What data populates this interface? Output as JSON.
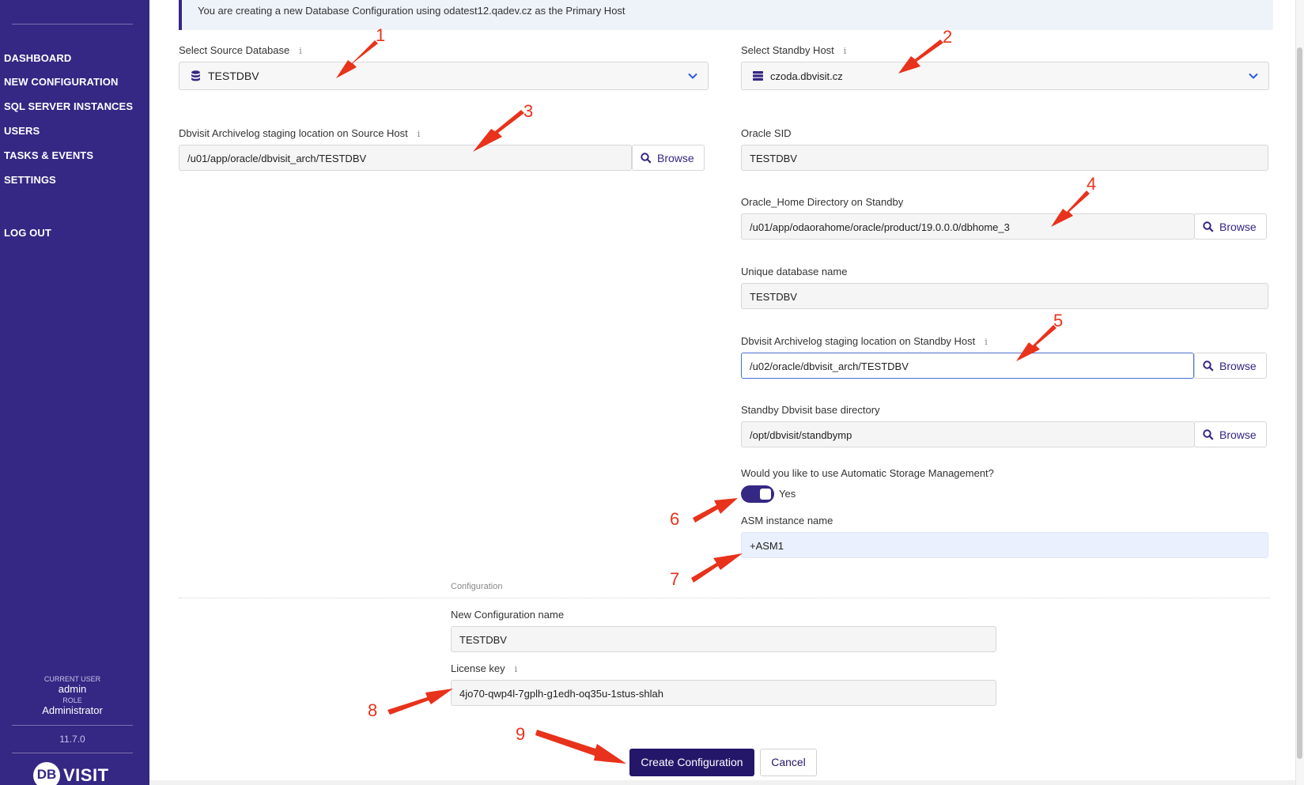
{
  "sidebar": {
    "nav": [
      "DASHBOARD",
      "NEW CONFIGURATION",
      "SQL SERVER INSTANCES",
      "USERS",
      "TASKS & EVENTS",
      "SETTINGS"
    ],
    "logout": "LOG OUT",
    "current_user_label": "CURRENT USER",
    "current_user": "admin",
    "role_label": "ROLE",
    "role": "Administrator",
    "version": "11.7.0",
    "logo": {
      "db": "DB",
      "visit": "VISIT"
    }
  },
  "banner": "You are creating a new Database Configuration using odatest12.qadev.cz as the Primary Host",
  "form": {
    "source_db": {
      "label": "Select Source Database",
      "value": "TESTDBV",
      "icon": "database-icon"
    },
    "standby_host": {
      "label": "Select Standby Host",
      "value": "czoda.dbvisit.cz",
      "icon": "server-icon"
    },
    "source_staging": {
      "label": "Dbvisit Archivelog staging location on Source Host",
      "value": "/u01/app/oracle/dbvisit_arch/TESTDBV"
    },
    "oracle_sid": {
      "label": "Oracle SID",
      "value": "TESTDBV"
    },
    "oracle_home": {
      "label": "Oracle_Home Directory on Standby",
      "value": "/u01/app/odaorahome/oracle/product/19.0.0.0/dbhome_3"
    },
    "unique_db_name": {
      "label": "Unique database name",
      "value": "TESTDBV"
    },
    "standby_staging": {
      "label": "Dbvisit Archivelog staging location on Standby Host",
      "value": "/u02/oracle/dbvisit_arch/TESTDBV"
    },
    "standby_base_dir": {
      "label": "Standby Dbvisit base directory",
      "value": "/opt/dbvisit/standbymp"
    },
    "asm_question": {
      "label": "Would you like to use Automatic Storage Management?",
      "toggle_label": "Yes",
      "enabled": true
    },
    "asm_instance": {
      "label": "ASM instance name",
      "value": "+ASM1"
    },
    "browse_label": "Browse",
    "info_glyph": "i"
  },
  "configuration": {
    "section_label": "Configuration",
    "name": {
      "label": "New Configuration name",
      "value": "TESTDBV"
    },
    "license": {
      "label": "License key",
      "value": "4jo70-qwp4l-7gplh-g1edh-oq35u-1stus-shlah"
    }
  },
  "buttons": {
    "create": "Create Configuration",
    "cancel": "Cancel"
  },
  "annotations": [
    "1",
    "2",
    "3",
    "4",
    "5",
    "6",
    "7",
    "8",
    "9"
  ],
  "colors": {
    "sidebar": "#352784",
    "primary_button": "#24176a",
    "annotation": "#e8321b",
    "accent": "#352784"
  }
}
